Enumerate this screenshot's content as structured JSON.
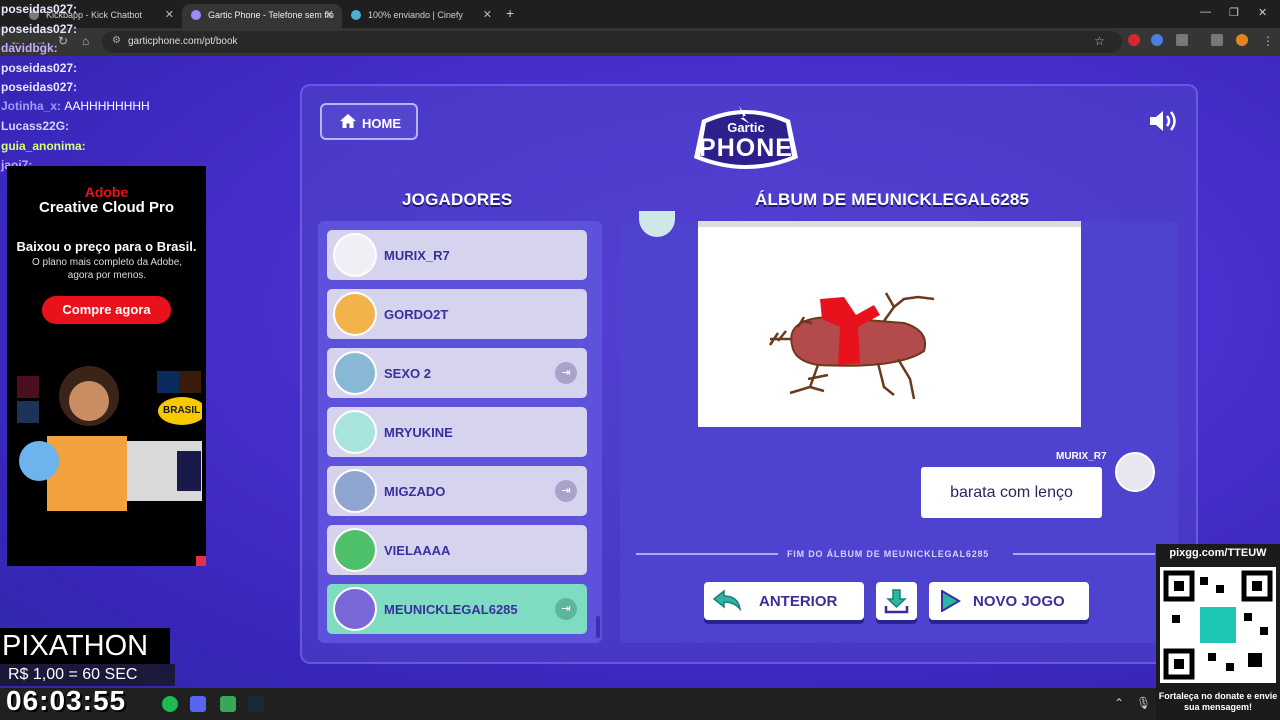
{
  "browser": {
    "tabs": [
      {
        "title": "Kickbapp - Kick Chatbot"
      },
      {
        "title": "Gartic Phone - Telefone sem fio"
      },
      {
        "title": "100% enviando | Cinefy"
      }
    ],
    "url": "garticphone.com/pt/book"
  },
  "game": {
    "home_label": "HOME",
    "logo_top": "Gartic",
    "logo_main": "PHONE",
    "players_title": "JOGADORES",
    "album_title": "ÁLBUM DE MEUNICKLEGAL6285",
    "players": [
      {
        "name": "MURIX_R7",
        "kick": false
      },
      {
        "name": "GORDO2T",
        "kick": false
      },
      {
        "name": "SEXO 2",
        "kick": true
      },
      {
        "name": "MRYUKINE",
        "kick": false
      },
      {
        "name": "MIGZADO",
        "kick": true
      },
      {
        "name": "VIELAAAA",
        "kick": false
      },
      {
        "name": "MEUNICKLEGAL6285",
        "kick": true,
        "active": true
      }
    ],
    "author": "MURIX_R7",
    "guess": "barata com lenço",
    "end_text": "FIM DO ÁLBUM DE MEUNICKLEGAL6285",
    "prev_label": "ANTERIOR",
    "new_game_label": "NOVO JOGO"
  },
  "chat": [
    {
      "user": "poseidas027:",
      "msg": ""
    },
    {
      "user": "poseidas027:",
      "msg": ""
    },
    {
      "user": "davidbgk:",
      "msg": ""
    },
    {
      "user": "poseidas027:",
      "msg": ""
    },
    {
      "user": "poseidas027:",
      "msg": ""
    },
    {
      "user": "Jotinha_x:",
      "msg": "AAHHHHHHHH"
    },
    {
      "user": "Lucass22G:",
      "msg": ""
    },
    {
      "user": "guia_anonima:",
      "msg": ""
    },
    {
      "user": "jaoi7:",
      "msg": ""
    }
  ],
  "ad": {
    "brand": "Adobe",
    "product": "Creative Cloud Pro",
    "headline": "Baixou o preço para o Brasil.",
    "body": "O plano mais completo da Adobe, agora por menos.",
    "cta": "Compre agora",
    "badge": "BRASIL"
  },
  "overlay": {
    "pixathon": "PIXATHON",
    "rate": "R$ 1,00 = 60 SEC",
    "timer": "06:03:55",
    "qr_url": "pixgg.com/TTEUW",
    "qr_caption": "Fortaleça no donate e envie sua mensagem!"
  },
  "colors": {
    "accent": "#3a2f9c",
    "active_row": "#7fdcc2",
    "ad_red": "#e9121c"
  }
}
